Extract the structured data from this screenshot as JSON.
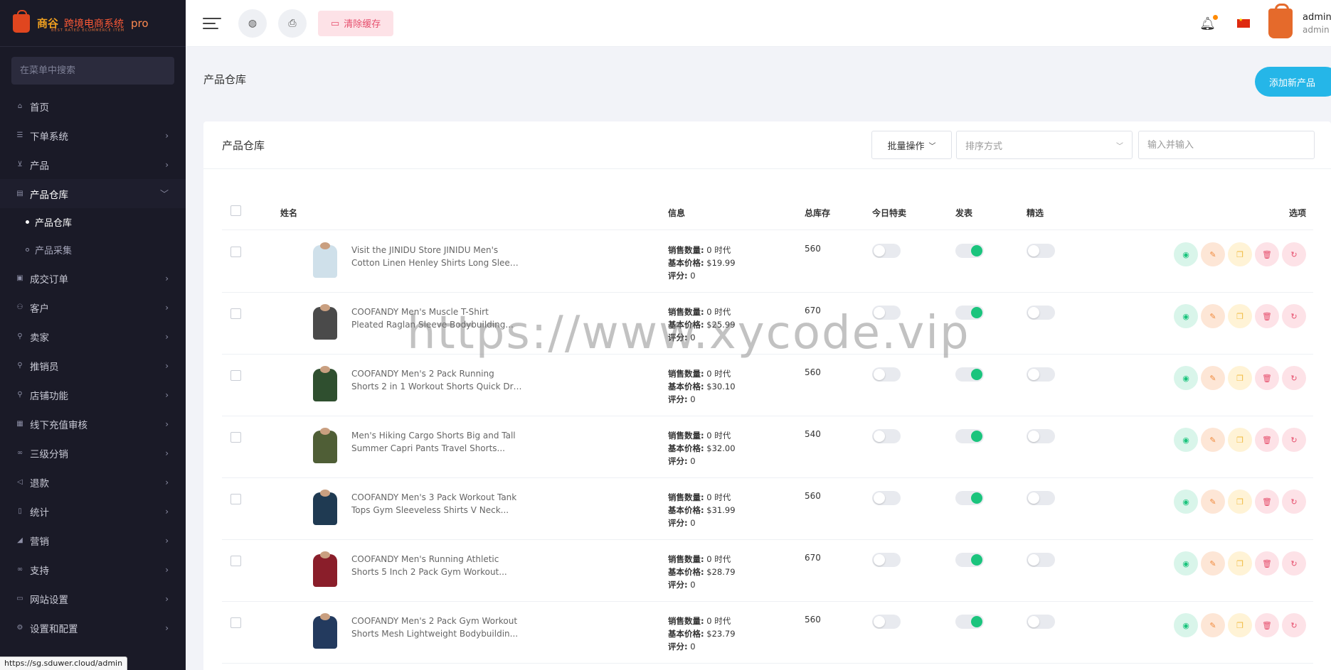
{
  "brand": {
    "name": "商谷",
    "system": "跨境电商系统",
    "edition": "pro",
    "tagline": "BEST RATED ECOMMERCE ITEM"
  },
  "sidebar": {
    "search_placeholder": "在菜单中搜索",
    "items": [
      {
        "label": "首页",
        "icon": "home-icon",
        "has_children": false
      },
      {
        "label": "下单系统",
        "icon": "list-icon",
        "has_children": true
      },
      {
        "label": "产品",
        "icon": "cart-icon",
        "has_children": true
      },
      {
        "label": "产品仓库",
        "icon": "warehouse-icon",
        "has_children": true,
        "open": true
      },
      {
        "label": "成交订单",
        "icon": "order-icon",
        "has_children": true
      },
      {
        "label": "客户",
        "icon": "users-icon",
        "has_children": true
      },
      {
        "label": "卖家",
        "icon": "user-icon",
        "has_children": true
      },
      {
        "label": "推销员",
        "icon": "user-icon",
        "has_children": true
      },
      {
        "label": "店铺功能",
        "icon": "user-icon",
        "has_children": true
      },
      {
        "label": "线下充值审核",
        "icon": "money-icon",
        "has_children": true
      },
      {
        "label": "三级分销",
        "icon": "link-icon",
        "has_children": true
      },
      {
        "label": "退款",
        "icon": "back-icon",
        "has_children": true
      },
      {
        "label": "统计",
        "icon": "doc-icon",
        "has_children": true
      },
      {
        "label": "营销",
        "icon": "megaphone-icon",
        "has_children": true
      },
      {
        "label": "支持",
        "icon": "link-icon",
        "has_children": true
      },
      {
        "label": "网站设置",
        "icon": "monitor-icon",
        "has_children": true
      },
      {
        "label": "设置和配置",
        "icon": "gear-icon",
        "has_children": true
      }
    ],
    "sub_items": [
      {
        "label": "产品仓库",
        "active": true
      },
      {
        "label": "产品采集",
        "active": false
      }
    ]
  },
  "status_url": "https://sg.sduwer.cloud/admin",
  "topbar": {
    "clear_cache_label": "清除缓存",
    "user_name": "admin",
    "user_role": "admin"
  },
  "page": {
    "title": "产品仓库",
    "add_button": "添加新产品"
  },
  "card": {
    "title": "产品仓库",
    "bulk_label": "批量操作",
    "sort_placeholder": "排序方式",
    "search_placeholder": "输入并输入"
  },
  "table": {
    "headers": {
      "name": "姓名",
      "info": "信息",
      "stock": "总库存",
      "today_deal": "今日特卖",
      "published": "发表",
      "featured": "精选",
      "options": "选项"
    },
    "info_labels": {
      "sales": "销售数量:",
      "price": "基本价格:",
      "rating": "评分:"
    },
    "rows": [
      {
        "line1": "Visit the JINIDU Store JINIDU Men's",
        "line2": "Cotton Linen Henley Shirts Long Sleev...",
        "sales": "0 时代",
        "price": "$19.99",
        "rating": "0",
        "stock": "560",
        "today_deal": false,
        "published": true,
        "featured": false,
        "thumb_color": "#cfe0ea"
      },
      {
        "line1": "COOFANDY Men's Muscle T-Shirt",
        "line2": "Pleated Raglan Sleeve Bodybuilding...",
        "sales": "0 时代",
        "price": "$25.99",
        "rating": "0",
        "stock": "670",
        "today_deal": false,
        "published": true,
        "featured": false,
        "thumb_color": "#4a4a4a"
      },
      {
        "line1": "COOFANDY Men's 2 Pack Running",
        "line2": "Shorts 2 in 1 Workout Shorts Quick Dry...",
        "sales": "0 时代",
        "price": "$30.10",
        "rating": "0",
        "stock": "560",
        "today_deal": false,
        "published": true,
        "featured": false,
        "thumb_color": "#2f4f2f"
      },
      {
        "line1": "Men's Hiking Cargo Shorts Big and Tall",
        "line2": "Summer Capri Pants Travel Shorts...",
        "sales": "0 时代",
        "price": "$32.00",
        "rating": "0",
        "stock": "540",
        "today_deal": false,
        "published": true,
        "featured": false,
        "thumb_color": "#4f5e36"
      },
      {
        "line1": "COOFANDY Men's 3 Pack Workout Tank",
        "line2": "Tops Gym Sleeveless Shirts V Neck...",
        "sales": "0 时代",
        "price": "$31.99",
        "rating": "0",
        "stock": "560",
        "today_deal": false,
        "published": true,
        "featured": false,
        "thumb_color": "#1f3a52"
      },
      {
        "line1": "COOFANDY Men's Running Athletic",
        "line2": "Shorts 5 Inch 2 Pack Gym Workout...",
        "sales": "0 时代",
        "price": "$28.79",
        "rating": "0",
        "stock": "670",
        "today_deal": false,
        "published": true,
        "featured": false,
        "thumb_color": "#8a1e2a"
      },
      {
        "line1": "COOFANDY Men's 2 Pack Gym Workout",
        "line2": "Shorts Mesh Lightweight Bodybuildin...",
        "sales": "0 时代",
        "price": "$23.79",
        "rating": "0",
        "stock": "560",
        "today_deal": false,
        "published": true,
        "featured": false,
        "thumb_color": "#233a5e"
      }
    ]
  },
  "watermark": "https://www.xycode.vip",
  "colors": {
    "sidebar_bg": "#1a1a27",
    "primary": "#25b6e8",
    "toggle_on": "#1bc47d",
    "danger": "#e64e6c"
  }
}
